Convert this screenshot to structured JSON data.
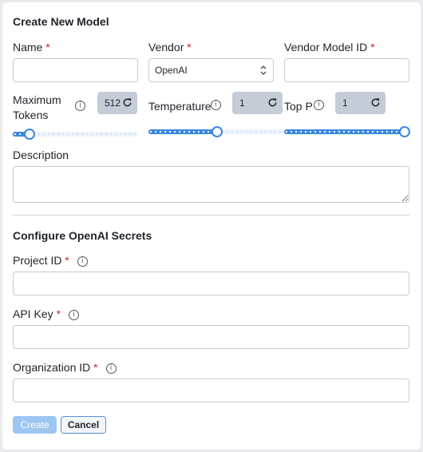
{
  "form": {
    "title": "Create New Model",
    "required_mark": "*",
    "info_glyph": "i",
    "name_label": "Name",
    "name_value": "",
    "vendor_label": "Vendor",
    "vendor_selected": "OpenAI",
    "vendor_model_id_label": "Vendor Model ID",
    "vendor_model_id_value": "",
    "max_tokens_label_line1": "Maximum",
    "max_tokens_label_line2": "Tokens",
    "max_tokens_value": "512",
    "max_tokens_level": 0.13,
    "temperature_label": "Temperature",
    "temperature_value": "1",
    "temperature_level": 0.5,
    "top_p_label": "Top P",
    "top_p_value": "1",
    "top_p_level": 1.0,
    "description_label": "Description",
    "description_value": ""
  },
  "secrets": {
    "title": "Configure OpenAI Secrets",
    "project_id_label": "Project ID",
    "project_id_value": "",
    "api_key_label": "API Key",
    "api_key_value": "",
    "organization_id_label": "Organization ID",
    "organization_id_value": ""
  },
  "actions": {
    "create_label": "Create",
    "cancel_label": "Cancel"
  },
  "colors": {
    "accent": "#3a88de",
    "required": "#d1242f",
    "create_disabled": "#9ec6f3"
  }
}
